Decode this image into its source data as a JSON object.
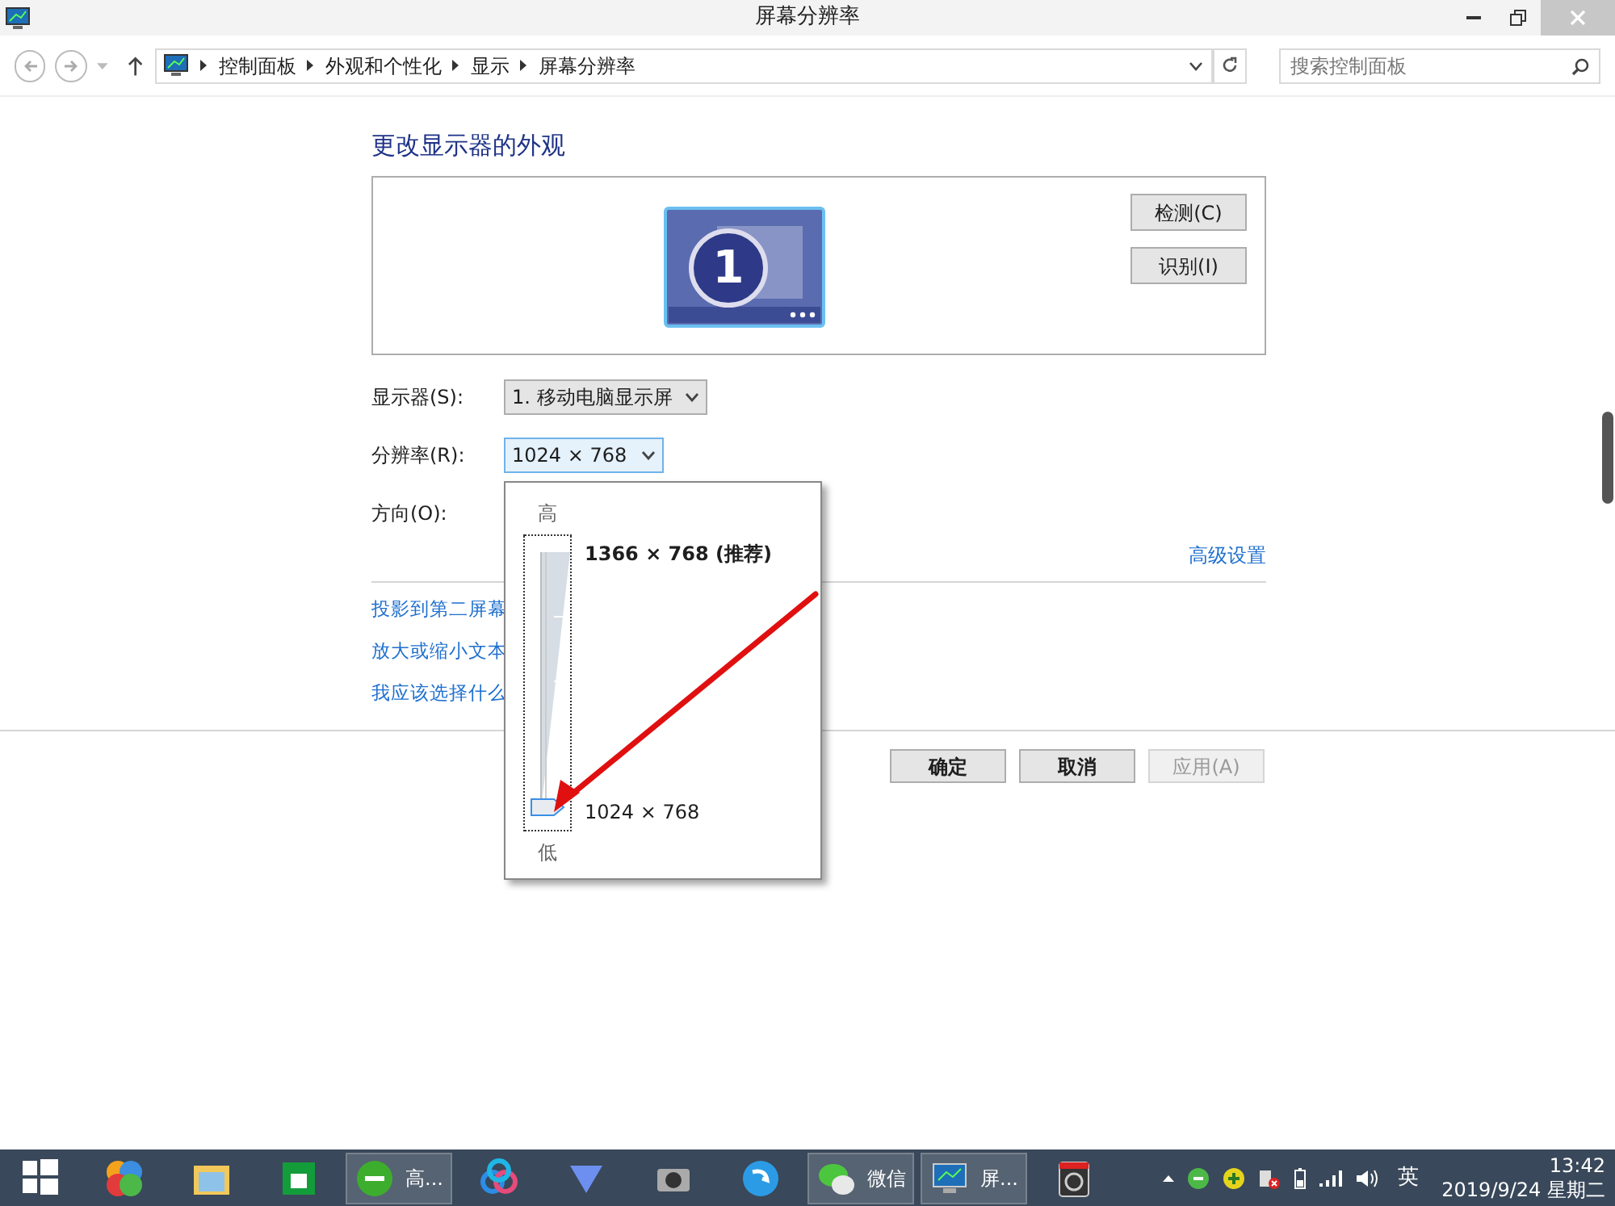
{
  "window": {
    "title": "屏幕分辨率"
  },
  "address_bar": {
    "path": [
      "控制面板",
      "外观和个性化",
      "显示",
      "屏幕分辨率"
    ]
  },
  "search": {
    "placeholder": "搜索控制面板"
  },
  "heading": "更改显示器的外观",
  "monitor": {
    "number": "1"
  },
  "side_buttons": [
    "检测(C)",
    "识别(I)"
  ],
  "settings": [
    {
      "label": "显示器(S):",
      "value": "1. 移动电脑显示屏",
      "open": false
    },
    {
      "label": "分辨率(R):",
      "value": "1024 × 768",
      "open": true
    },
    {
      "label": "方向(O):"
    }
  ],
  "dropdown": {
    "high_label": "高",
    "low_label": "低",
    "level": 0,
    "options": [
      {
        "text": "1366 × 768 (推荐)",
        "recommended": true
      },
      {
        "text": "1024 × 768",
        "recommended": false
      }
    ]
  },
  "advanced_link": "高级设置",
  "links": [
    "投影到第二屏幕",
    "放大或缩小文本",
    "我应该选择什么"
  ],
  "buttons": [
    {
      "label": "确定",
      "disabled": false
    },
    {
      "label": "取消",
      "disabled": false
    },
    {
      "label": "应用(A)",
      "disabled": true
    }
  ],
  "taskbar": {
    "items": [
      {
        "kind": "start"
      },
      {
        "kind": "icon"
      },
      {
        "kind": "icon"
      },
      {
        "kind": "icon"
      },
      {
        "kind": "app",
        "label": "高..."
      },
      {
        "kind": "icon"
      },
      {
        "kind": "icon"
      },
      {
        "kind": "icon"
      },
      {
        "kind": "icon"
      },
      {
        "kind": "app",
        "label": "微信"
      },
      {
        "kind": "app",
        "label": "屏..."
      },
      {
        "kind": "icon"
      }
    ],
    "ime": "英",
    "time": "13:42",
    "date": "2019/9/24 星期二"
  }
}
